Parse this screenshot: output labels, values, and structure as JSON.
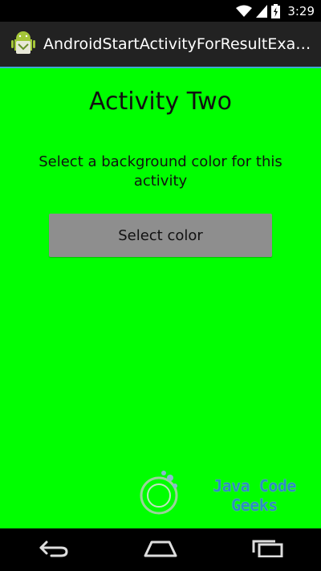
{
  "status_bar": {
    "time": "3:29",
    "icons": [
      "wifi-icon",
      "signal-icon",
      "battery-charging-icon"
    ]
  },
  "action_bar": {
    "title": "AndroidStartActivityForResultExam...",
    "icon": "android-icon",
    "background": "#222222"
  },
  "content": {
    "background": "#00ff00",
    "heading": "Activity Two",
    "prompt": "Select a background color for this activity",
    "button_label": "Select color"
  },
  "watermark": {
    "icon": "jcg-logo",
    "text": "Java Code Geeks"
  },
  "nav_bar": {
    "icons": [
      "back-icon",
      "home-icon",
      "recents-icon"
    ]
  }
}
